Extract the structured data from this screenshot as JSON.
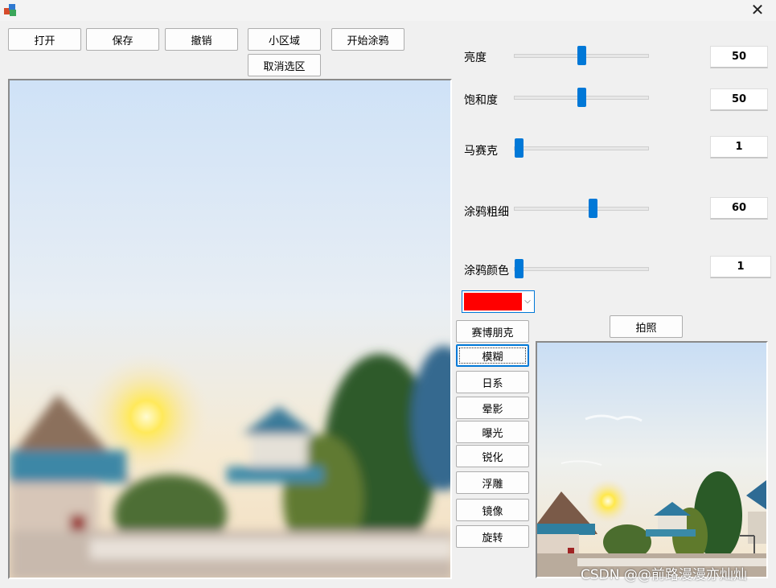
{
  "window": {
    "close_icon": "close-icon",
    "close_glyph": "✕"
  },
  "toolbar": {
    "open": "打开",
    "save": "保存",
    "undo": "撤销",
    "small_region": "小区域",
    "start_doodle": "开始涂鸦",
    "cancel_selection": "取消选区"
  },
  "adjustments": [
    {
      "label": "亮度",
      "value": "50",
      "level": 0.5
    },
    {
      "label": "饱和度",
      "value": "50",
      "level": 0.5
    },
    {
      "label": "马赛克",
      "value": "1",
      "level": 0.0
    },
    {
      "label": "涂鸦粗细",
      "value": "60",
      "level": 0.59
    },
    {
      "label": "涂鸦颜色",
      "value": "1",
      "level": 0.0
    }
  ],
  "color_combo": {
    "color": "#ff0000",
    "arrow": "⌵"
  },
  "filters": [
    "赛博朋克",
    "模糊",
    "日系",
    "晕影",
    "曝光",
    "锐化",
    "浮雕",
    "镜像",
    "旋转"
  ],
  "photo_button": "拍照",
  "watermark": "CSDN @@前路漫漫亦灿灿"
}
